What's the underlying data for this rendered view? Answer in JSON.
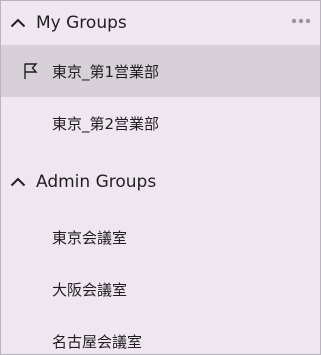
{
  "my_groups": {
    "title": "My Groups",
    "more_icon": "more-horizontal-icon",
    "items": [
      {
        "label": "東京_第1営業部",
        "selected": true,
        "icon": "flag-icon"
      },
      {
        "label": "東京_第2営業部",
        "selected": false
      }
    ]
  },
  "admin_groups": {
    "title": "Admin Groups",
    "items": [
      {
        "label": "東京会議室"
      },
      {
        "label": "大阪会議室"
      },
      {
        "label": "名古屋会議室"
      }
    ]
  },
  "colors": {
    "panel_background": "#f0e6f1",
    "selected_background": "#d8d0d9",
    "text": "#1f1f1f",
    "more_icon": "#9a949c"
  }
}
